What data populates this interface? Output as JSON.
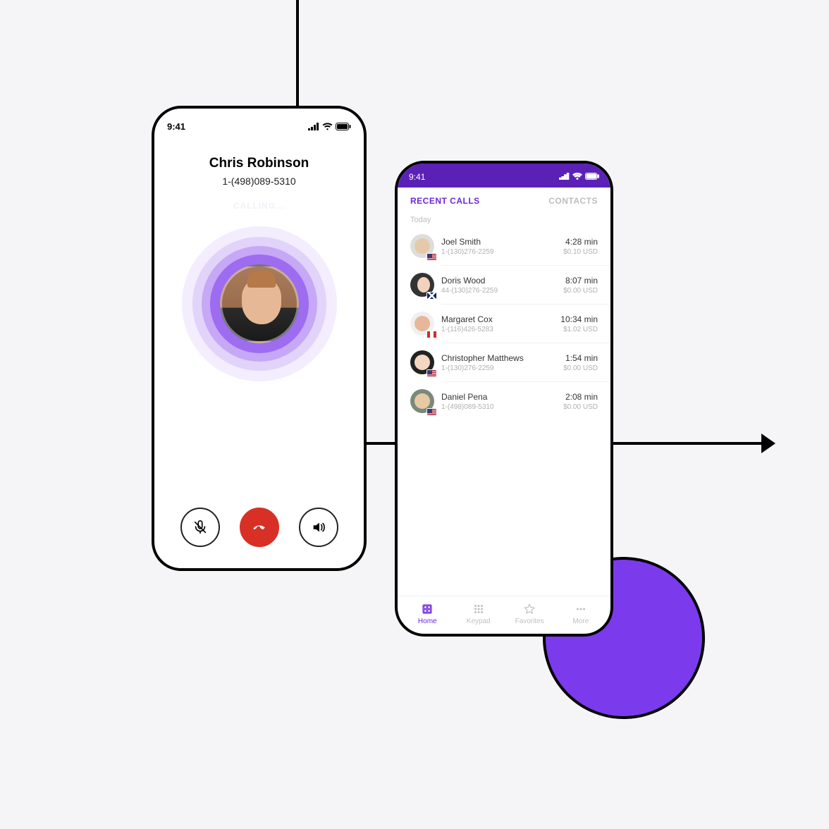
{
  "colors": {
    "accent": "#6d28d9",
    "end_call": "#d93025",
    "deco_purple": "#7c3aed"
  },
  "status_time": "9:41",
  "call": {
    "name": "Chris Robinson",
    "number": "1-(498)089-5310",
    "status": "CALLING…",
    "actions": {
      "mute": "Mute",
      "end": "End call",
      "speaker": "Speaker"
    }
  },
  "phone2": {
    "tabs": {
      "recent": "RECENT CALLS",
      "contacts": "CONTACTS"
    },
    "section": "Today",
    "rows": [
      {
        "name": "Joel Smith",
        "number": "1-(130)276-2259",
        "duration": "4:28 min",
        "cost": "$0.10 USD",
        "flag": "us"
      },
      {
        "name": "Doris Wood",
        "number": "44-(130)276-2259",
        "duration": "8:07 min",
        "cost": "$0.00 USD",
        "flag": "uk"
      },
      {
        "name": "Margaret Cox",
        "number": "1-(116)426-5283",
        "duration": "10:34 min",
        "cost": "$1.02 USD",
        "flag": "ca"
      },
      {
        "name": "Christopher Matthews",
        "number": "1-(130)276-2259",
        "duration": "1:54 min",
        "cost": "$0.00 USD",
        "flag": "us"
      },
      {
        "name": "Daniel Pena",
        "number": "1-(498)089-5310",
        "duration": "2:08 min",
        "cost": "$0.00 USD",
        "flag": "us"
      }
    ],
    "tabbar": {
      "home": "Home",
      "keypad": "Keypad",
      "favorites": "Favorites",
      "more": "More"
    }
  }
}
